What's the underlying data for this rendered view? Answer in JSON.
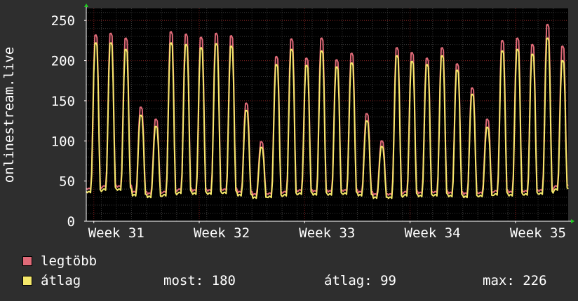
{
  "chart_data": {
    "type": "line",
    "ylabel": "onlinestream.live",
    "ylim": [
      0,
      265
    ],
    "y_ticks": [
      "0",
      "50",
      "100",
      "150",
      "200",
      "250"
    ],
    "x_ticks": [
      "Week 31",
      "Week 32",
      "Week 33",
      "Week 34",
      "Week 35"
    ],
    "grid": true,
    "colors": {
      "background": "#000000",
      "page": "#2e2e2e",
      "max_line": "#e06a78",
      "avg_line": "#f5e86a",
      "grid_minor": "#3a3a3a",
      "grid_major": "#7a1a1a",
      "axis": "#ffffff",
      "arrow": "#22cc22"
    },
    "daily_peaks": [
      {
        "max": 232,
        "avg": 222,
        "low": 37
      },
      {
        "max": 234,
        "avg": 222,
        "low": 40
      },
      {
        "max": 228,
        "avg": 214,
        "low": 40
      },
      {
        "max": 142,
        "avg": 132,
        "low": 33
      },
      {
        "max": 127,
        "avg": 118,
        "low": 31
      },
      {
        "max": 236,
        "avg": 222,
        "low": 33
      },
      {
        "max": 233,
        "avg": 220,
        "low": 36
      },
      {
        "max": 229,
        "avg": 216,
        "low": 35
      },
      {
        "max": 234,
        "avg": 221,
        "low": 35
      },
      {
        "max": 231,
        "avg": 218,
        "low": 36
      },
      {
        "max": 147,
        "avg": 138,
        "low": 33
      },
      {
        "max": 99,
        "avg": 92,
        "low": 30
      },
      {
        "max": 205,
        "avg": 195,
        "low": 31
      },
      {
        "max": 227,
        "avg": 214,
        "low": 33
      },
      {
        "max": 203,
        "avg": 194,
        "low": 35
      },
      {
        "max": 228,
        "avg": 212,
        "low": 34
      },
      {
        "max": 201,
        "avg": 192,
        "low": 34
      },
      {
        "max": 209,
        "avg": 197,
        "low": 35
      },
      {
        "max": 134,
        "avg": 125,
        "low": 33
      },
      {
        "max": 100,
        "avg": 93,
        "low": 30
      },
      {
        "max": 216,
        "avg": 206,
        "low": 30
      },
      {
        "max": 210,
        "avg": 199,
        "low": 33
      },
      {
        "max": 203,
        "avg": 195,
        "low": 32
      },
      {
        "max": 216,
        "avg": 206,
        "low": 33
      },
      {
        "max": 196,
        "avg": 188,
        "low": 32
      },
      {
        "max": 166,
        "avg": 158,
        "low": 31
      },
      {
        "max": 127,
        "avg": 117,
        "low": 32
      },
      {
        "max": 225,
        "avg": 212,
        "low": 34
      },
      {
        "max": 228,
        "avg": 214,
        "low": 33
      },
      {
        "max": 220,
        "avg": 208,
        "low": 34
      },
      {
        "max": 245,
        "avg": 228,
        "low": 35
      },
      {
        "max": 218,
        "avg": 200,
        "low": 40
      }
    ],
    "series": [
      {
        "name": "legtöbb",
        "color": "#e06a78"
      },
      {
        "name": "átlag",
        "color": "#f5e86a"
      }
    ],
    "stats": {
      "most_label": "most:",
      "most_value": "180",
      "atlag_label": "átlag:",
      "atlag_value": "99",
      "max_label": "max:",
      "max_value": "226"
    }
  }
}
